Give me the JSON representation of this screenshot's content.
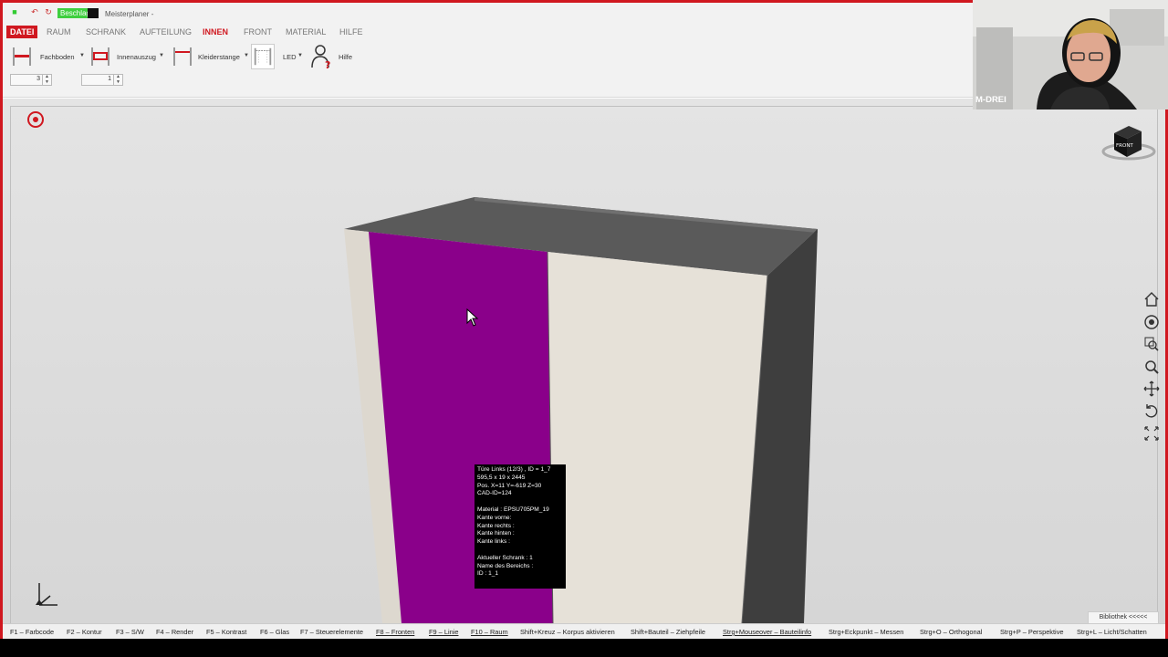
{
  "window": {
    "title": "Meisterplaner -",
    "badge": "Beschlag"
  },
  "menu": {
    "datei": "DATEI",
    "items": [
      "RAUM",
      "SCHRANK",
      "AUFTEILUNG",
      "INNEN",
      "FRONT",
      "MATERIAL",
      "HILFE"
    ],
    "active": "INNEN"
  },
  "ribbon": {
    "fachboden": "Fachboden",
    "innenauszug": "Innenauszug",
    "kleiderstange": "Kleiderstange",
    "led": "LED",
    "hilfe": "Hilfe",
    "spin1": "3",
    "spin2": "1"
  },
  "tooltip": {
    "line1": "Türe Links (12/3) , ID = 1_7",
    "line2": "595,5 x 19 x 2445",
    "line3": "Pos. X=11 Y=-619 Z=30",
    "line4": "CAD-ID=124",
    "line5": "Material : EPSU705PM_19",
    "line6": "Kante vorne:",
    "line7": "Kante rechts :",
    "line8": "Kante hinten :",
    "line9": "Kante links :",
    "line10": "Aktueller Schrank : 1",
    "line11": "Name des Bereichs :",
    "line12": "ID : 1_1"
  },
  "navcube": {
    "label": "FRONT"
  },
  "library": "Bibliothek <<<<<",
  "webcam": {
    "label": "M-DREI"
  },
  "statusbar": [
    "F1 – Farbcode",
    "F2 – Kontur",
    "F3 – S/W",
    "F4 – Render",
    "F5 – Kontrast",
    "F6 – Glas",
    "F7 – Steuerelemente",
    "F8 – Fronten",
    "F9 – Linie",
    "F10 – Raum",
    "Shift+Kreuz – Korpus aktivieren",
    "Shift+Bauteil – Ziehpfeile",
    "Strg+Mouseover – Bauteilinfo",
    "Strg+Eckpunkt – Messen",
    "Strg+O – Orthogonal",
    "Strg+P – Perspektive",
    "Strg+L – Licht/Schatten"
  ],
  "colors": {
    "accent": "#d01820",
    "door_left": "#8a008a",
    "door_right": "#e6e1d8",
    "top": "#5a5a5a",
    "side_right": "#3e3e3e",
    "side_left": "#ddd8cf"
  }
}
